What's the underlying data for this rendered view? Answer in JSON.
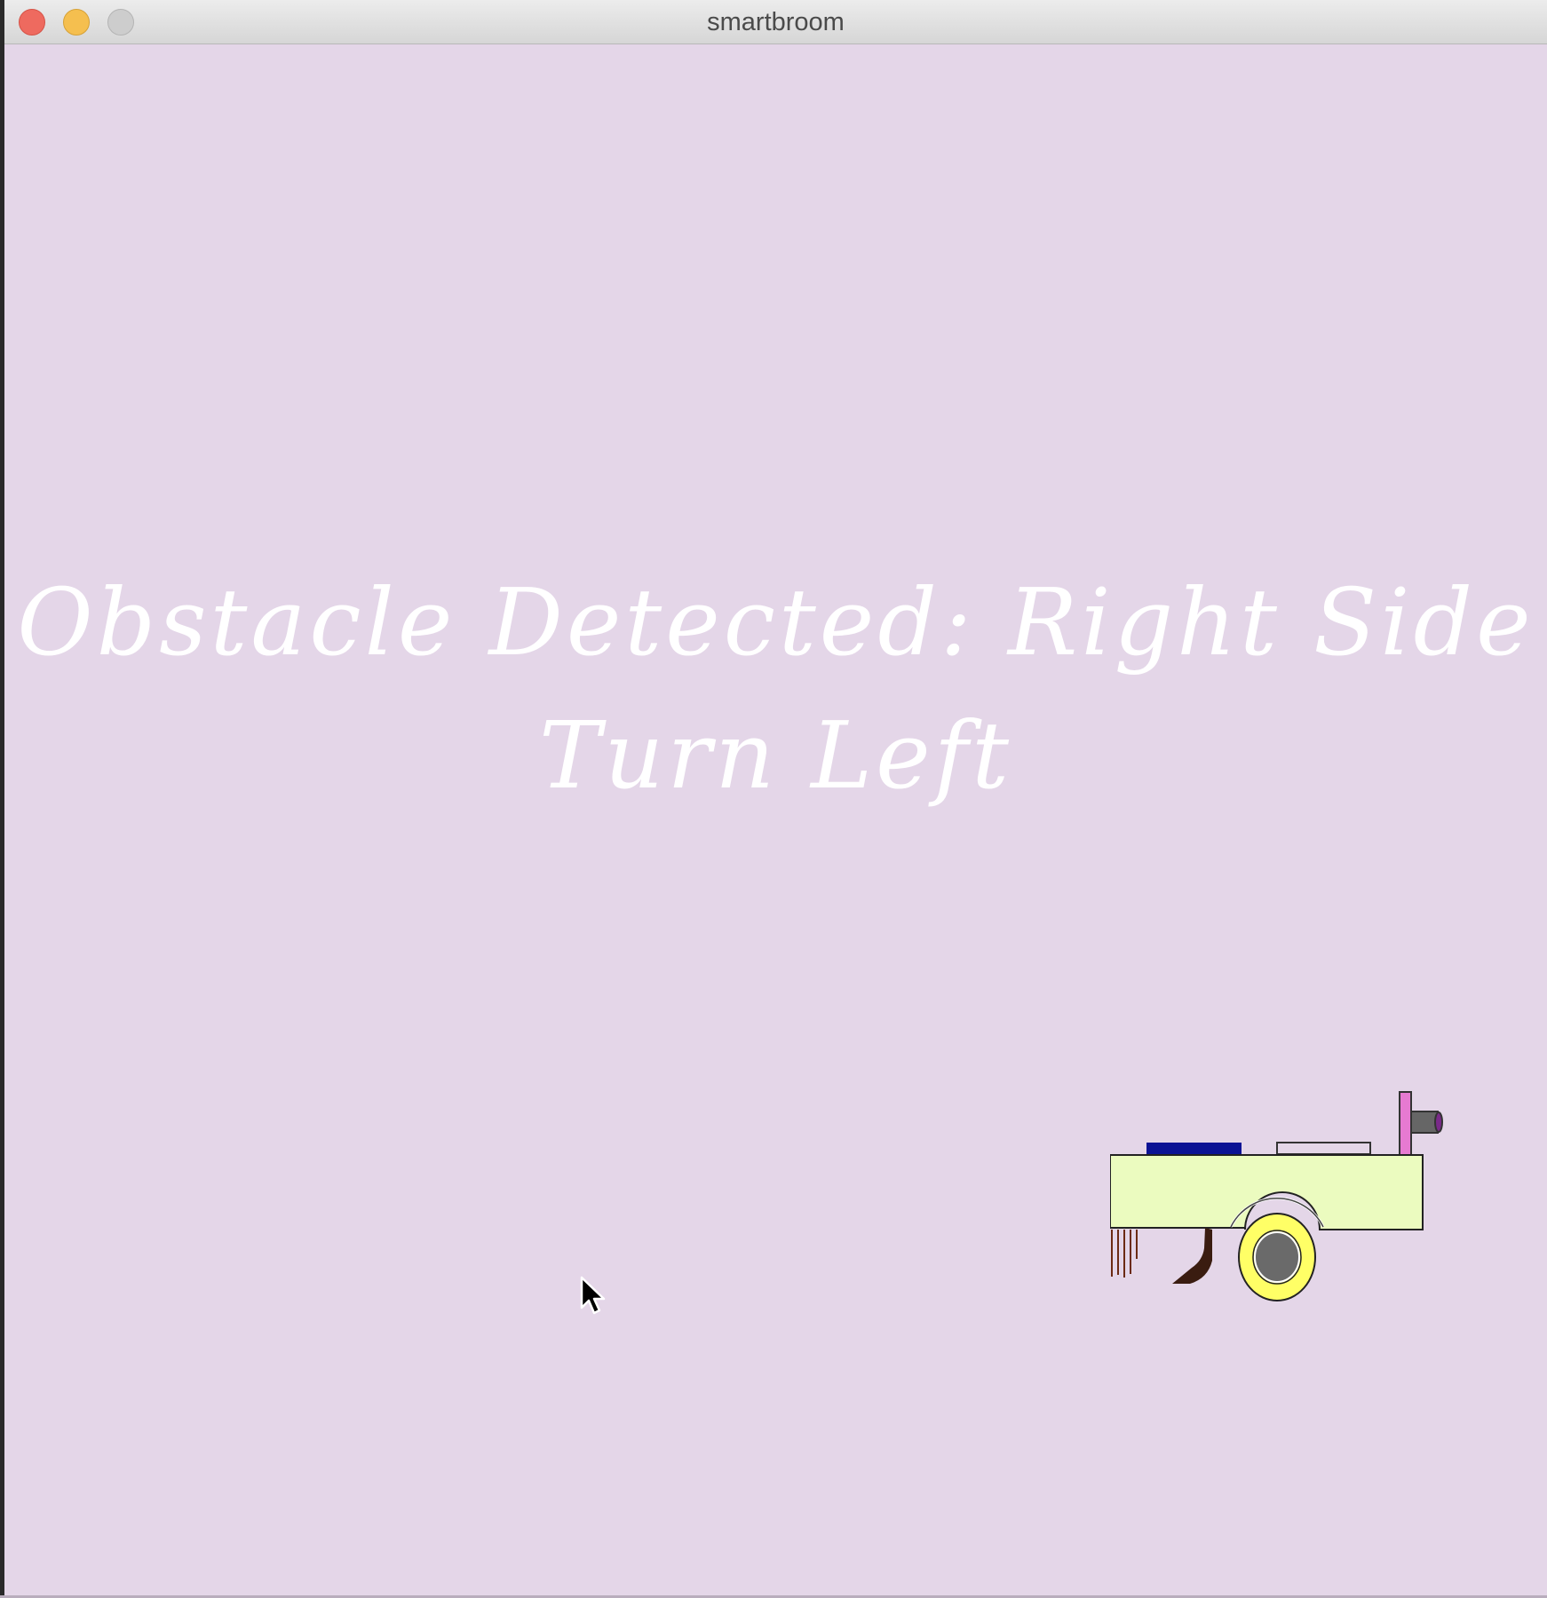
{
  "window": {
    "title": "smartbroom",
    "controls": [
      "close",
      "minimize",
      "zoom"
    ]
  },
  "canvas": {
    "background": "#e4d6e8",
    "message_line1": "Obstacle Detected: Right Side",
    "message_line2": "Turn Left"
  },
  "robot": {
    "icon": "smartbroom-robot-icon",
    "body_color": "#ebfbbf",
    "wheel_color": "#ffff66"
  }
}
